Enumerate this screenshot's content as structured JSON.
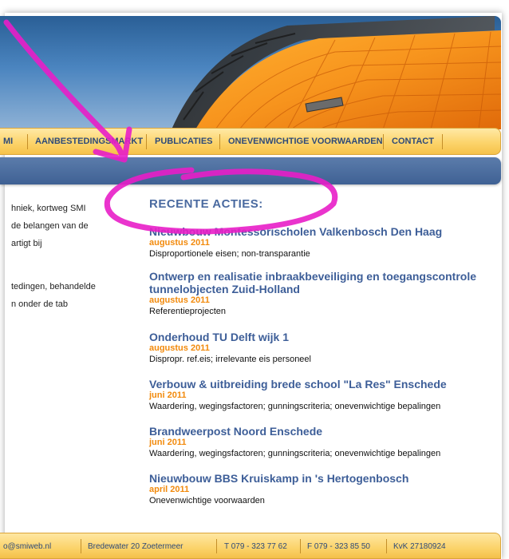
{
  "nav": {
    "items": [
      "MI",
      "AANBESTEDINGSMARKT",
      "PUBLICATIES",
      "ONEVENWICHTIGE VOORWAARDEN",
      "CONTACT"
    ]
  },
  "intro": {
    "lines": [
      "hniek, kortweg SMI",
      "de belangen van de",
      "artigt bij",
      "tedingen, behandelde",
      "n onder de tab"
    ]
  },
  "recent": {
    "title": "RECENTE ACTIES:",
    "actions": [
      {
        "title": "Nieuwbouw Montessorischolen Valkenbosch Den Haag",
        "date": "augustus 2011",
        "category": "Disproportionele eisen; non-transparantie"
      },
      {
        "title": "Ontwerp en realisatie inbraakbeveiliging en toegangscontrole tunnelobjecten Zuid-Holland",
        "date": "augustus 2011",
        "category": "Referentieprojecten"
      },
      {
        "title": "Onderhoud TU Delft wijk 1",
        "date": "augustus 2011",
        "category": "Dispropr. ref.eis; irrelevante eis personeel"
      },
      {
        "title": "Verbouw & uitbreiding brede school \"La Res\" Enschede",
        "date": "juni 2011",
        "category": "Waardering, wegingsfactoren; gunningscriteria; onevenwichtige bepalingen"
      },
      {
        "title": "Brandweerpost Noord Enschede",
        "date": "juni 2011",
        "category": "Waardering, wegingsfactoren; gunningscriteria; onevenwichtige bepalingen"
      },
      {
        "title": "Nieuwbouw BBS Kruiskamp in 's Hertogenbosch",
        "date": "april 2011",
        "category": "Onevenwichtige voorwaarden"
      }
    ]
  },
  "footer": {
    "email": "o@smiweb.nl",
    "address": "Bredewater 20 Zoetermeer",
    "phone": "T 079 - 323 77 62",
    "fax": "F 079 - 323 85 50",
    "kvk": "KvK 27180924"
  },
  "colors": {
    "nav_bg": "#fcd46b",
    "nav_text": "#2e4a78",
    "bluebar": "#4a6b9c",
    "title_blue": "#3d5e98",
    "date_orange": "#f28a0c",
    "annotation_magenta": "#e81ec8"
  }
}
